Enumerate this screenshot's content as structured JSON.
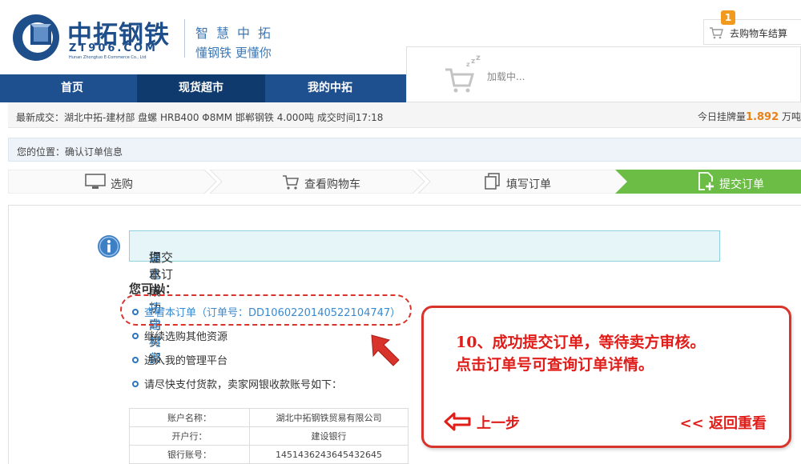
{
  "brand": {
    "name_cn": "中拓钢铁",
    "domain": "ZT906.COM",
    "name_en": "Hunan Zhongtuo E-Commerce Co., Ltd",
    "slogan_line1": "智慧中拓",
    "slogan_line2": "懂钢铁 更懂你"
  },
  "cart": {
    "badge_count": "1",
    "label": "去购物车结算",
    "loading_text": "加载中..."
  },
  "nav": {
    "items": [
      {
        "label": "首页"
      },
      {
        "label": "现货超市"
      },
      {
        "label": "我的中拓"
      }
    ]
  },
  "ticker": {
    "latest": "最新成交：湖北中拓-建材部 盘螺 HRB400 Φ8MM 邯郸钢铁 4.000吨 成交时间17:18",
    "today_prefix": "今日挂牌量",
    "today_value": "1.892",
    "today_unit": "万吨"
  },
  "breadcrumb": "您的位置：确认订单信息",
  "steps": [
    {
      "label": "选购",
      "icon": "monitor-icon"
    },
    {
      "label": "查看购物车",
      "icon": "cart-icon"
    },
    {
      "label": "填写订单",
      "icon": "copy-icon"
    },
    {
      "label": "提交订单",
      "icon": "add-doc-icon"
    }
  ],
  "success": {
    "prefix": "您已成功向卖家",
    "seller": "湖北中拓-建材部",
    "suffix": "提交本订单！"
  },
  "options": {
    "title": "您可以：",
    "view_order": "查看本订单（订单号：DD1060220140522104747）",
    "continue": "继续选购其他资源",
    "manage": "进入我的管理平台",
    "pay": "请尽快支付货款，卖家网银收款账号如下："
  },
  "account": [
    {
      "key": "账户名称：",
      "value": "湖北中拓钢铁贸易有限公司"
    },
    {
      "key": "开户行：",
      "value": "建设银行"
    },
    {
      "key": "银行账号：",
      "value": "1451436243645432645"
    }
  ],
  "callout": {
    "line1": "10、成功提交订单，等待卖方审核。",
    "line2": "点击订单号可查询订单详情。",
    "prev": "上一步",
    "back": "<< 返回重看"
  },
  "colors": {
    "nav_bg": "#1e4f8e",
    "active_step": "#6cbd45",
    "callout_red": "#e01d18",
    "highlight_orange": "#e8811a"
  }
}
